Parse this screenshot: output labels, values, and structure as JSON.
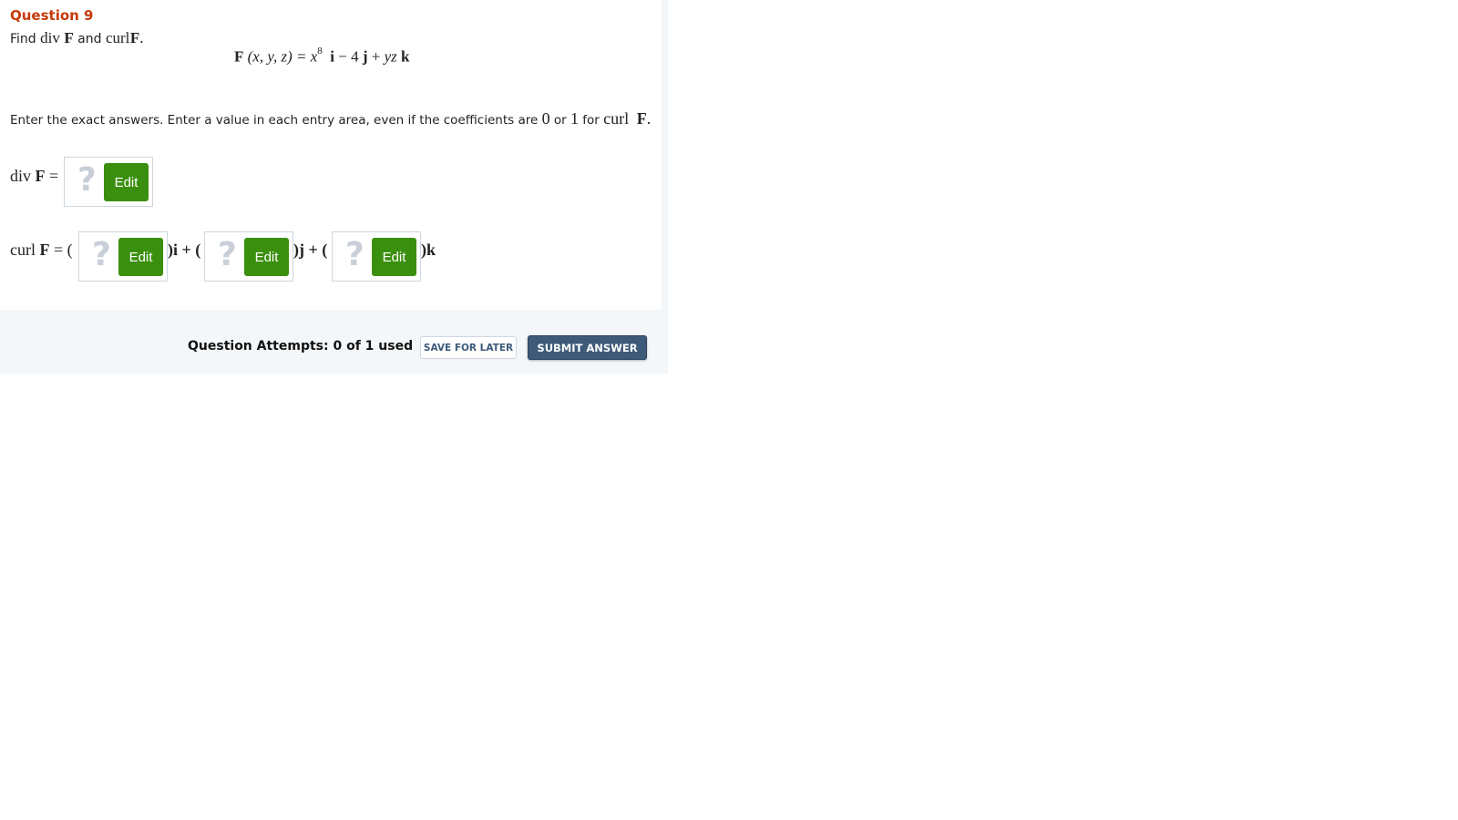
{
  "question": {
    "title": "Question 9",
    "prompt": {
      "find": "Find",
      "div": "div",
      "F": "F",
      "and": "and",
      "curl": "curl",
      "end": "."
    },
    "formula": {
      "lhs_F": "F",
      "lhs_args": "(x, y, z) = ",
      "x": "x",
      "exp": "8",
      "i": "i",
      "minus4": " − 4 ",
      "j": "j",
      "plus": " + ",
      "yz": "yz",
      "k": "k"
    },
    "instructions": {
      "text1": "Enter the exact answers. Enter a value in each entry area, even if the coefficients are ",
      "zero": "0",
      "or": " or ",
      "one": "1",
      "for": " for ",
      "curl": "curl",
      "F": "F",
      "end": "."
    }
  },
  "answers": {
    "div_label": "div",
    "div_F": "F",
    "equals": "=",
    "curl_label": "curl",
    "curl_F": "F",
    "curl_equals": "= (",
    "i_suffix": ")i + (",
    "j_suffix": ")j + (",
    "k_suffix": ")k",
    "placeholder_glyph": "?",
    "edit_label": "Edit"
  },
  "footer": {
    "attempts": "Question Attempts: 0 of 1 used",
    "save_label": "SAVE FOR LATER",
    "submit_label": "SUBMIT ANSWER"
  },
  "colors": {
    "title": "#c73a0a",
    "edit_button": "#3b8f0e",
    "submit_button": "#3d5a78",
    "footer_bg": "#f4f7fa"
  }
}
